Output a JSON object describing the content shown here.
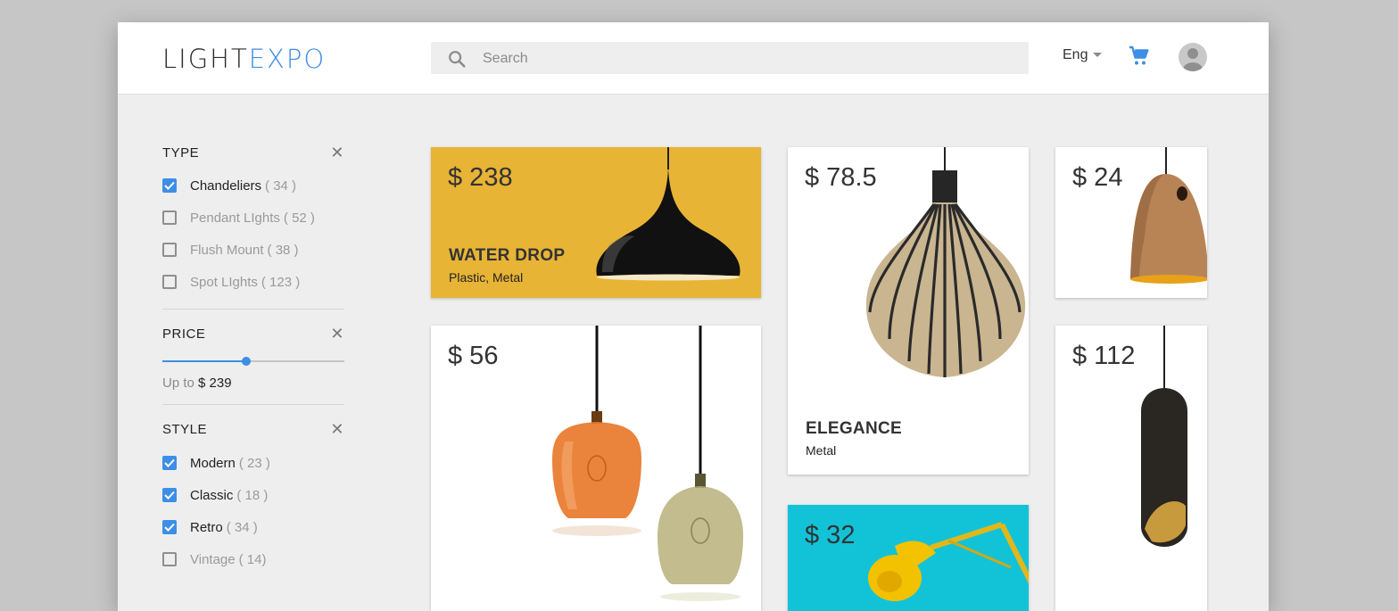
{
  "app": {
    "logo_part1": "LIGHT",
    "logo_part2": "EXPO"
  },
  "search": {
    "placeholder": "Search",
    "value": ""
  },
  "header": {
    "language": "Eng"
  },
  "icons": {
    "search": "search-icon",
    "language_caret": "caret-down-icon",
    "cart": "cart-icon",
    "avatar": "user-avatar-icon",
    "close": "close-icon",
    "checkbox": "checkbox-icon"
  },
  "colors": {
    "accent": "#3d8ee6",
    "yellow_card": "#e8b436",
    "cyan_card": "#12c3d8"
  },
  "filters": {
    "type": {
      "title": "TYPE",
      "close": "✕",
      "options": [
        {
          "label": "Chandeliers",
          "count": "( 34 )",
          "checked": true
        },
        {
          "label": "Pendant LIghts",
          "count": "( 52 )",
          "checked": false
        },
        {
          "label": "Flush Mount",
          "count": "( 38 )",
          "checked": false
        },
        {
          "label": "Spot LIghts",
          "count": "( 123 )",
          "checked": false
        }
      ]
    },
    "price": {
      "title": "PRICE",
      "close": "✕",
      "prefix": "Up to",
      "value": "$ 239",
      "slider_fraction": 0.46
    },
    "style": {
      "title": "STYLE",
      "close": "✕",
      "options": [
        {
          "label": "Modern",
          "count": "( 23 )",
          "checked": true
        },
        {
          "label": "Classic",
          "count": "( 18 )",
          "checked": true
        },
        {
          "label": "Retro",
          "count": "( 34 )",
          "checked": true
        },
        {
          "label": "Vintage",
          "count": "( 14)",
          "checked": false
        }
      ]
    }
  },
  "products": [
    {
      "price": "$ 238",
      "name": "WATER DROP",
      "material": "Plastic, Metal"
    },
    {
      "price": "$ 78.5",
      "name": "ELEGANCE",
      "material": "Metal"
    },
    {
      "price": "$ 24"
    },
    {
      "price": "$ 56"
    },
    {
      "price": "$ 112"
    },
    {
      "price": "$ 32"
    }
  ]
}
